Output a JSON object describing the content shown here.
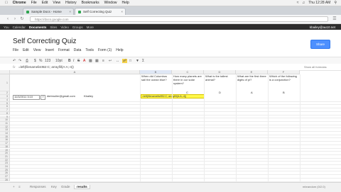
{
  "mac_menu": {
    "app": "Chrome",
    "items": [
      "File",
      "Edit",
      "View",
      "History",
      "Bookmarks",
      "Window",
      "Help"
    ],
    "clock": "Thu 12:28 AM"
  },
  "tabs": [
    {
      "label": "Sample Docs - Home",
      "active": false
    },
    {
      "label": "Self Correcting Quiz",
      "active": true
    }
  ],
  "address": "https://docs.google.com",
  "google_bar": {
    "items": [
      "You",
      "Calendar",
      "Documents",
      "Sites",
      "Video",
      "Groups",
      "More"
    ],
    "selected_index": 2,
    "email": "kbailey@au10.net"
  },
  "document": {
    "title": "Self Correcting Quiz",
    "share_label": "Share",
    "menus": [
      "File",
      "Edit",
      "View",
      "Insert",
      "Format",
      "Data",
      "Tools",
      "Form (1)",
      "Help"
    ]
  },
  "toolbar": {
    "font_size": "10pt",
    "buttons": [
      "undo",
      "redo",
      "print",
      "currency",
      "percent",
      "format",
      "font",
      "bold",
      "italic",
      "strike",
      "text-color",
      "fill-color",
      "borders",
      "align",
      "wrap",
      "merge",
      "insert-link",
      "comment",
      "filter",
      "functions"
    ]
  },
  "formula_bar": {
    "label": "fx",
    "content": "=left(filenamelist!B2:C; arrayfill(A:A;-4))",
    "right_text": "Show all formulas"
  },
  "grid": {
    "columns": [
      "",
      "A",
      "B",
      "C",
      "D",
      "E",
      "F"
    ],
    "header_row": {
      "row_num": "1",
      "questions": [
        "When did Columbus sail the ocean blue?",
        "How many planets are there in our solar system?",
        "What is the tallest animal?",
        "What are the first three digits of pi?",
        "Which of the following is a conjunction?"
      ]
    },
    "key_row": {
      "row_num": "2",
      "answers": [
        "C",
        "D",
        "A",
        "B"
      ],
      "highlighted": "=left(filenamelist!B2:C; arrayfill(A:A;-4))"
    },
    "entry_row": {
      "row_num": "3",
      "timestamp": "11/3/2011 3:10",
      "flag": "7",
      "email": "kbrtmuller@gmail.com",
      "name": "Kbailey"
    },
    "row_numbers": [
      "4",
      "5",
      "6",
      "7",
      "8",
      "9",
      "10",
      "11",
      "12",
      "13",
      "14",
      "15",
      "16",
      "17",
      "18",
      "19",
      "20",
      "21",
      "22",
      "23",
      "24",
      "25",
      "26",
      "27",
      "28"
    ]
  },
  "sheets": {
    "tabs": [
      "Responses",
      "Key",
      "Grade",
      "results"
    ],
    "active_index": 3,
    "status": "mbrandom (0/2.0)"
  }
}
